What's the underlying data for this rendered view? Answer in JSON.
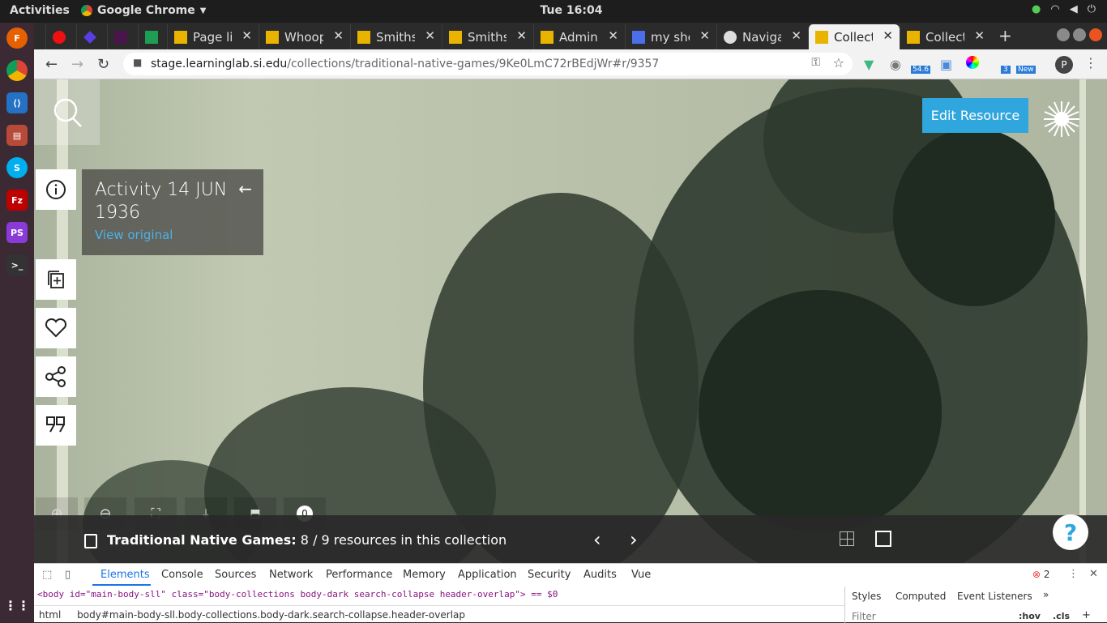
{
  "topbar": {
    "activities": "Activities",
    "app_name": "Google Chrome",
    "clock": "Tue 16:04"
  },
  "tabs": [
    {
      "title": "",
      "fav": "#e11"
    },
    {
      "title": "",
      "fav": "#5b3de6"
    },
    {
      "title": "",
      "fav": "#4a154b"
    },
    {
      "title": "",
      "fav": "#1e9e52"
    },
    {
      "title": "Page lis",
      "fav": "#e8b400"
    },
    {
      "title": "Whoop",
      "fav": "#e8b400"
    },
    {
      "title": "Smiths",
      "fav": "#e8b400"
    },
    {
      "title": "Smiths",
      "fav": "#e8b400"
    },
    {
      "title": "Admin",
      "fav": "#e8b400"
    },
    {
      "title": "my she",
      "fav": "#4b6fe8"
    },
    {
      "title": "Naviga",
      "fav": "#ddd"
    },
    {
      "title": "Collect",
      "fav": "#e8b400"
    },
    {
      "title": "Collect",
      "fav": "#e8b400"
    }
  ],
  "address": {
    "host": "stage.learninglab.si.edu",
    "path": "/collections/traditional-native-games/9Ke0LmC72rBEdjWr#r/9357"
  },
  "ext": {
    "badge1": "54.6",
    "badge2": "3",
    "badge3": "New",
    "profile": "P"
  },
  "resource": {
    "title": "Activity 14 JUN 1936",
    "link": "View original",
    "edit": "Edit Resource",
    "zero": "0"
  },
  "collection": {
    "name": "Traditional Native Games:",
    "count": "8 / 9 resources in this collection"
  },
  "help": "?",
  "devtools": {
    "tabs": [
      "Elements",
      "Console",
      "Sources",
      "Network",
      "Performance",
      "Memory",
      "Application",
      "Security",
      "Audits",
      "Vue"
    ],
    "errors": "2",
    "line": "<body id=\"main-body-sll\" class=\"body-collections body-dark search-collapse header-overlap\"> == $0",
    "crumb_html": "html",
    "crumb_body": "body#main-body-sll.body-collections.body-dark.search-collapse.header-overlap",
    "styles_tabs": [
      "Styles",
      "Computed",
      "Event Listeners"
    ],
    "filter": "Filter",
    "hov": ":hov",
    "cls": ".cls"
  }
}
